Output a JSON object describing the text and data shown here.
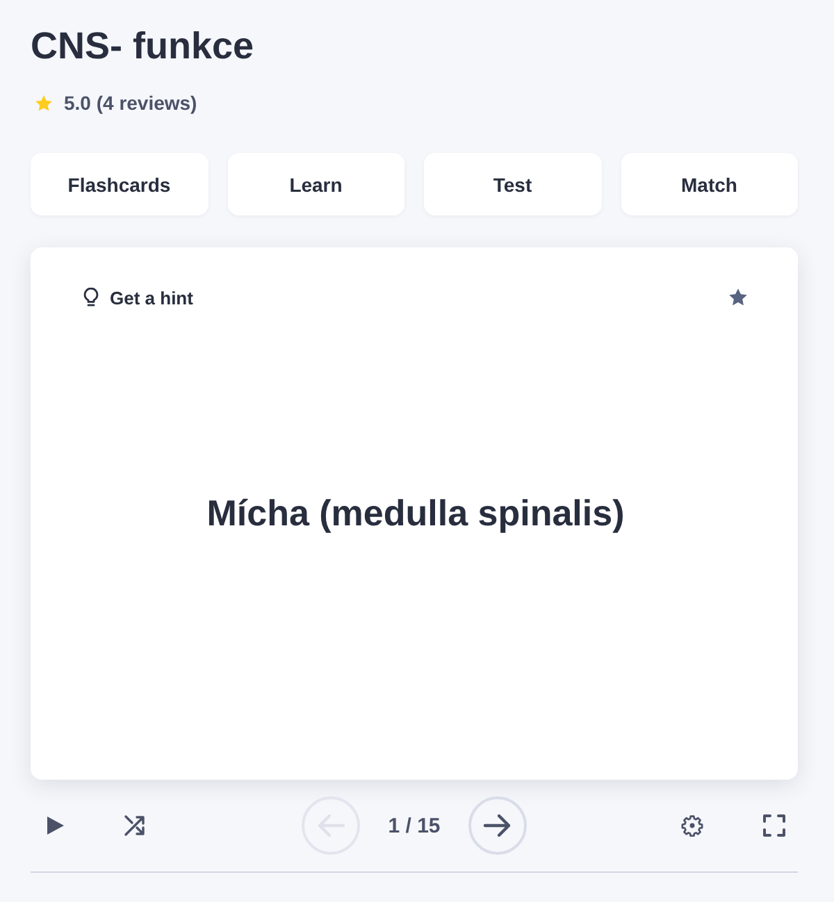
{
  "title": "CNS- funkce",
  "rating": {
    "text": "5.0 (4 reviews)"
  },
  "modes": [
    {
      "label": "Flashcards"
    },
    {
      "label": "Learn"
    },
    {
      "label": "Test"
    },
    {
      "label": "Match"
    }
  ],
  "card": {
    "hint": "Get a hint",
    "starred": false,
    "term": "Mícha (medulla spinalis)"
  },
  "controls": {
    "counter": "1 / 15",
    "previous": {
      "disabled": true
    },
    "next": {
      "disabled": false
    }
  }
}
